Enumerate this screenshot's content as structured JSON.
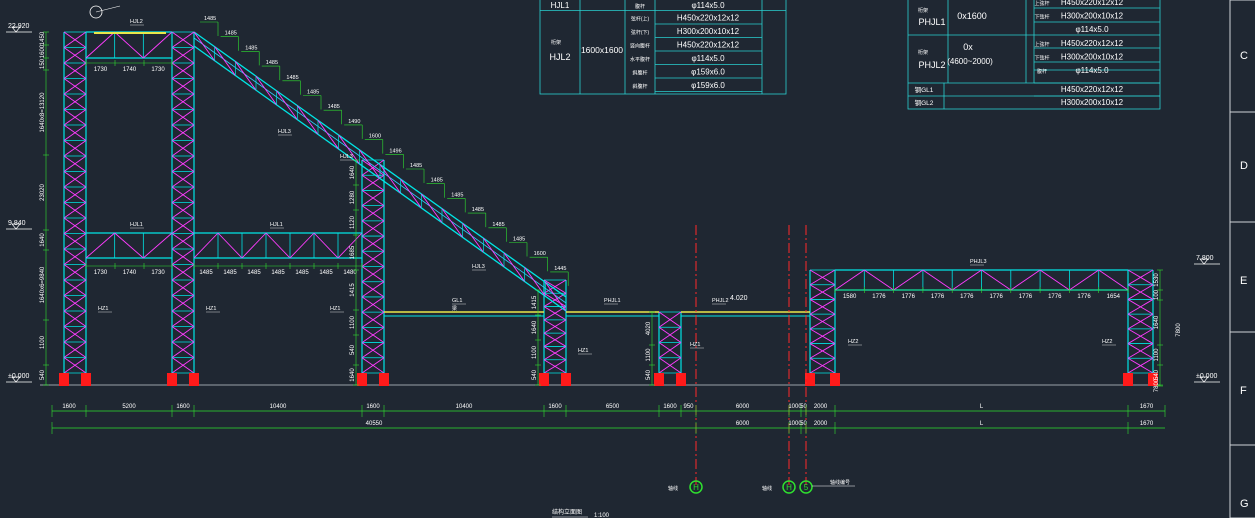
{
  "elevations": {
    "top": "22.920",
    "mid": "9.840",
    "right": "7.800",
    "ground": "±0.000",
    "ground_right": "±0.000",
    "bridge": "4.020"
  },
  "grid_letters": [
    "C",
    "D",
    "E",
    "F",
    "G"
  ],
  "axes": {
    "h": "H",
    "hb": "H",
    "hc": "5"
  },
  "dims": {
    "bay_left": [
      "1600",
      "5200",
      "1600",
      "10400",
      "1600",
      "10400",
      "1600",
      "6500",
      "1600",
      "950",
      "6000",
      "1000",
      "50",
      "2000",
      "L",
      "1670"
    ],
    "bay_total": [
      "40550",
      "6000",
      "1000",
      "50",
      "2000",
      "L",
      "1670"
    ],
    "top_truss": [
      "1730",
      "1740",
      "1730"
    ],
    "mid_truss_a": [
      "1730",
      "1740",
      "1730"
    ],
    "mid_truss_b": [
      "1485",
      "1485",
      "1485",
      "1485",
      "1485",
      "1485",
      "1480"
    ],
    "right_truss": [
      "1580",
      "1776",
      "1776",
      "1776",
      "1776",
      "1776",
      "1776",
      "1776",
      "1776",
      "1654"
    ],
    "stair_steps": [
      "1485",
      "1485",
      "1485",
      "1485",
      "1485",
      "1485",
      "1485",
      "1490",
      "1600",
      "1496",
      "1485",
      "1485",
      "1485",
      "1485",
      "1485",
      "1485",
      "1600",
      "1445"
    ],
    "left_vertical": [
      "1450",
      "1600",
      "150",
      "1640x8=13120",
      "23020",
      "1640",
      "1640x6=9840",
      "1100",
      "540"
    ],
    "col3_vertical": [
      "1640",
      "1280",
      "1120",
      "1685",
      "1415",
      "1100",
      "540",
      "1640"
    ],
    "col4_vertical": [
      "1415",
      "1640",
      "1100",
      "540"
    ],
    "col5_vertical": [
      "4020",
      "1100",
      "540"
    ],
    "right_vertical": [
      "1530",
      "100",
      "1640",
      "1100",
      "540",
      "7800"
    ]
  },
  "labels": {
    "truss_top": "HJL2",
    "truss_mid_a": "HJL1",
    "truss_mid_b": "HJL1",
    "stair_1": "HJL3",
    "stair_2": "HJL3",
    "stair_3": "HJL3",
    "gl1": "GL1",
    "gl1_sub": "梁",
    "phjl1": "PHJL1",
    "phjl2": "PHJL2",
    "right_truss": "PHJL3",
    "col_1": "HZ1",
    "col_2": "HZ1",
    "col_3": "HZ1",
    "col_4": "HZ1",
    "col_5": "HZ1",
    "col_6": "HZ2",
    "col_7": "HZ2",
    "drawing_title": "结构立面图",
    "drawing_scale": "1:100",
    "axis_tag_1": "轴线",
    "axis_tag_2": "轴线",
    "axis_tag_3": "轴线编号"
  },
  "table_left": {
    "r1": {
      "code": "HJL1",
      "part": "腹杆",
      "spec": "φ114x5.0"
    },
    "hjl2_type": "桁架",
    "hjl2_code": "HJL2",
    "hjl2_size": "1600x1600",
    "rows": [
      {
        "part": "弦杆(上)",
        "spec": "H450x220x12x12"
      },
      {
        "part": "弦杆(下)",
        "spec": "H300x200x10x12"
      },
      {
        "part": "竖向腹杆",
        "spec": "H450x220x12x12"
      },
      {
        "part": "水平腹杆",
        "spec": "φ114x5.0"
      },
      {
        "part": "斜腹杆",
        "spec": "φ159x6.0"
      },
      {
        "part": "斜腹杆",
        "spec": "φ159x6.0"
      }
    ]
  },
  "table_right": {
    "phjl1_type": "桁架",
    "phjl1_code": "PHJL1",
    "phjl1_size": "0x1600",
    "phjl1_rows": [
      {
        "part": "上弦杆",
        "spec": "H450x220x12x12"
      },
      {
        "part": "下弦杆",
        "spec": "H300x200x10x12"
      },
      {
        "part": "",
        "spec": "φ114x5.0"
      }
    ],
    "phjl2_type": "桁架",
    "phjl2_code": "PHJL2",
    "phjl2_size": "0x",
    "phjl2_size2": "(4600~2000)",
    "phjl2_rows": [
      {
        "part": "上弦杆",
        "spec": "H450x220x12x12"
      },
      {
        "part": "下弦杆",
        "spec": "H300x200x10x12"
      },
      {
        "part": "腹杆",
        "spec": "φ114x5.0"
      }
    ],
    "gl1": {
      "code": "钢GL1",
      "spec": "H450x220x12x12"
    },
    "gl2": {
      "code": "钢GL2",
      "spec": "H300x200x10x12"
    }
  },
  "colors": {
    "bg": "#1f2732",
    "chord": "#00e5e5",
    "web": "#ff3cff",
    "dim": "#2fe02f",
    "text": "#ffffff",
    "table": "#2ad0d0",
    "axis": "#ff2a2a",
    "base": "#ff1a1a"
  }
}
